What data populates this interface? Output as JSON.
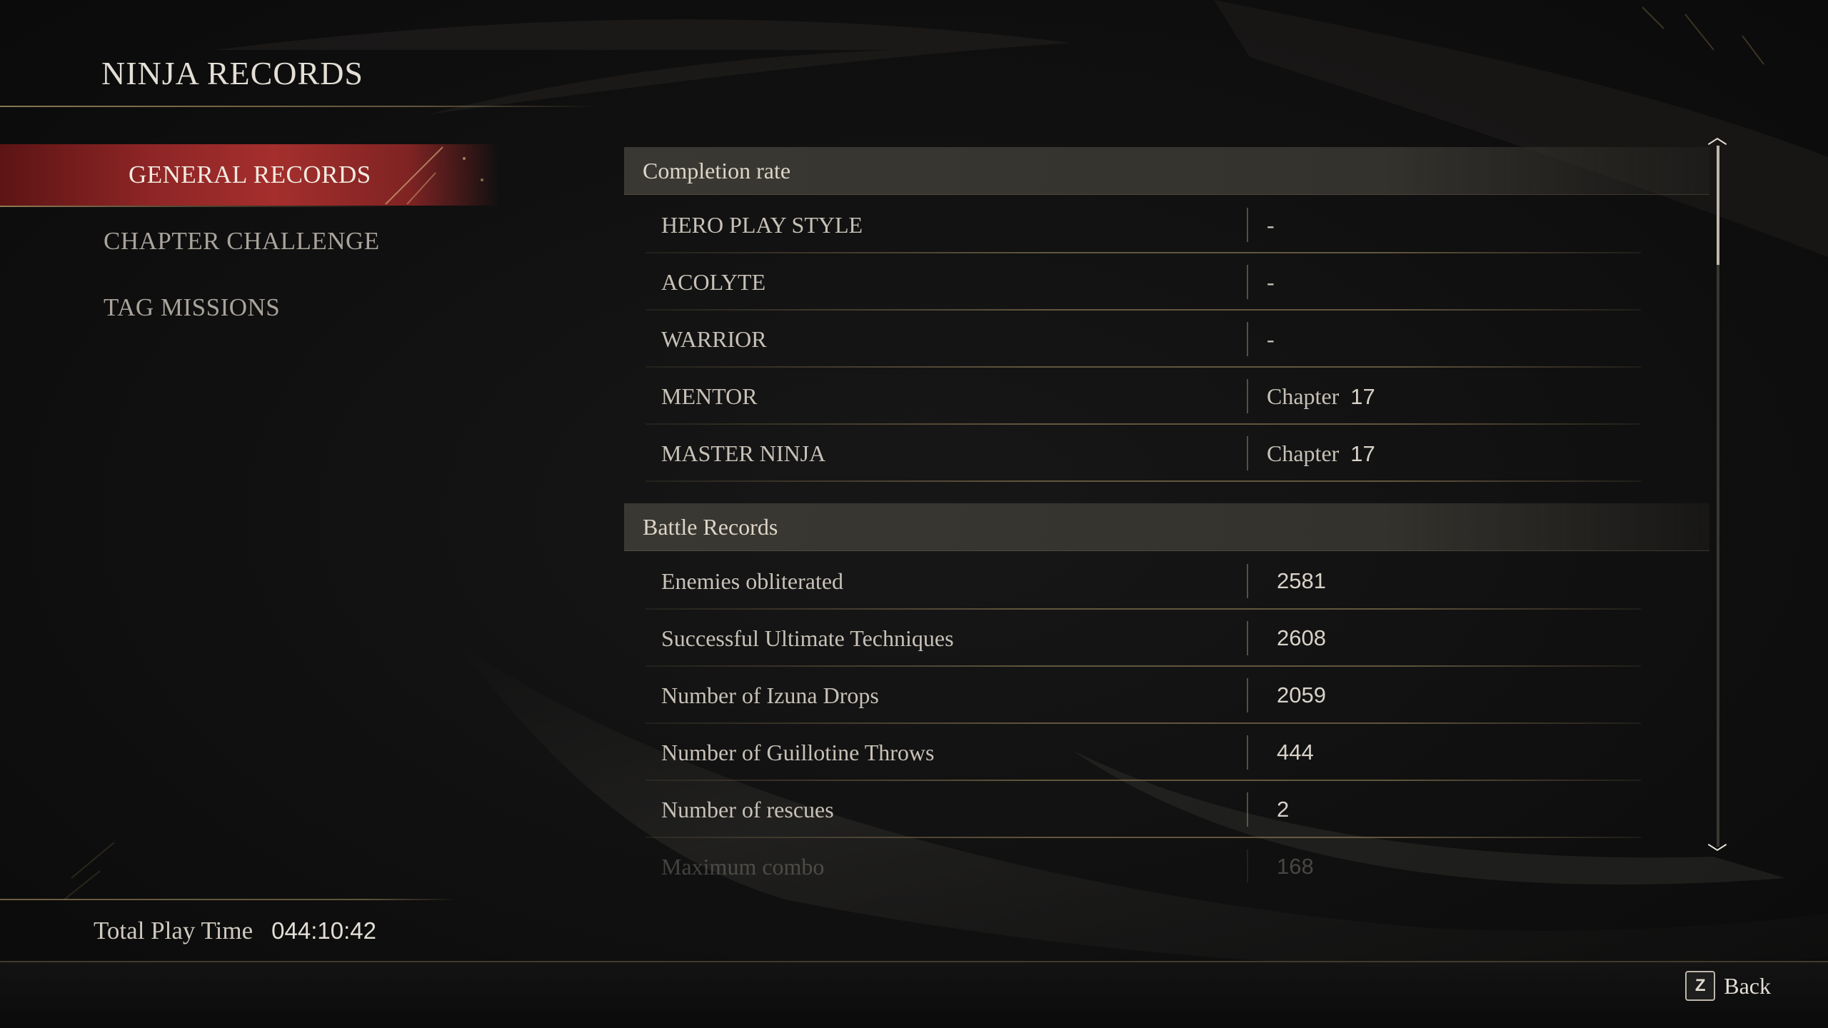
{
  "screen": {
    "title": "NINJA RECORDS"
  },
  "nav": {
    "items": [
      {
        "label": "GENERAL RECORDS",
        "active": true
      },
      {
        "label": "CHAPTER CHALLENGE",
        "active": false
      },
      {
        "label": "TAG MISSIONS",
        "active": false
      }
    ]
  },
  "sections": {
    "completion": {
      "header": "Completion rate",
      "rows": [
        {
          "label": "HERO PLAY STYLE",
          "value": "-"
        },
        {
          "label": "ACOLYTE",
          "value": "-"
        },
        {
          "label": "WARRIOR",
          "value": "-"
        },
        {
          "label": "MENTOR",
          "value_prefix": "Chapter",
          "value": "17"
        },
        {
          "label": "MASTER NINJA",
          "value_prefix": "Chapter",
          "value": "17"
        }
      ]
    },
    "battle": {
      "header": "Battle Records",
      "rows": [
        {
          "label": "Enemies obliterated",
          "value": "2581"
        },
        {
          "label": "Successful Ultimate Techniques",
          "value": "2608"
        },
        {
          "label": "Number of Izuna Drops",
          "value": "2059"
        },
        {
          "label": "Number of Guillotine Throws",
          "value": "444"
        },
        {
          "label": "Number of rescues",
          "value": "2"
        },
        {
          "label": "Maximum combo",
          "value": "168"
        }
      ]
    }
  },
  "scrollbar": {
    "up_glyph": "︿",
    "down_glyph": "﹀",
    "position_fraction": 0.0,
    "visible_fraction": 0.17
  },
  "footer": {
    "playtime_label": "Total Play Time",
    "playtime_value": "044:10:42",
    "back_key": "Z",
    "back_label": "Back"
  },
  "colors": {
    "accent_red": "#a42f2d",
    "gold_rule": "#96825a",
    "background": "#0f0f0f"
  }
}
